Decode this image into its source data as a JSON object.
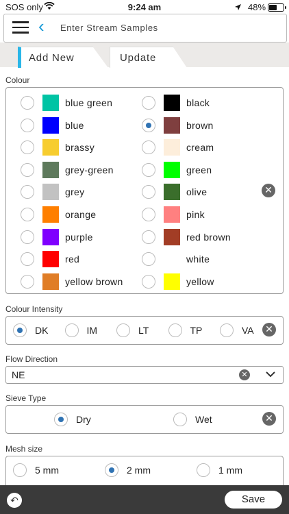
{
  "status_bar": {
    "carrier": "SOS only",
    "time": "9:24 am",
    "battery": "48%",
    "battery_level": 0.48
  },
  "header": {
    "title": "Enter Stream Samples"
  },
  "tabs": [
    {
      "label": "Add New",
      "active": true
    },
    {
      "label": "Update",
      "active": false
    }
  ],
  "colour": {
    "label": "Colour",
    "selected": "brown",
    "left": [
      {
        "name": "blue green",
        "hex": "#00c4a4"
      },
      {
        "name": "blue",
        "hex": "#0000ff"
      },
      {
        "name": "brassy",
        "hex": "#f7cd2f"
      },
      {
        "name": "grey-green",
        "hex": "#5e7a5c"
      },
      {
        "name": "grey",
        "hex": "#c2c2c2"
      },
      {
        "name": "orange",
        "hex": "#ff7f00"
      },
      {
        "name": "purple",
        "hex": "#7f00ff"
      },
      {
        "name": "red",
        "hex": "#ff0000"
      },
      {
        "name": "yellow brown",
        "hex": "#e07d26"
      }
    ],
    "right": [
      {
        "name": "black",
        "hex": "#000000"
      },
      {
        "name": "brown",
        "hex": "#7f3f3f"
      },
      {
        "name": "cream",
        "hex": "#fdeedb"
      },
      {
        "name": "green",
        "hex": "#00ff00"
      },
      {
        "name": "olive",
        "hex": "#3a6e2b"
      },
      {
        "name": "pink",
        "hex": "#ff8080"
      },
      {
        "name": "red brown",
        "hex": "#a23d25"
      },
      {
        "name": "white",
        "hex": "#ffffff"
      },
      {
        "name": "yellow",
        "hex": "#ffff00"
      }
    ]
  },
  "colour_intensity": {
    "label": "Colour Intensity",
    "options": [
      "DK",
      "IM",
      "LT",
      "TP",
      "VA"
    ],
    "selected": "DK"
  },
  "flow_direction": {
    "label": "Flow Direction",
    "value": "NE"
  },
  "sieve_type": {
    "label": "Sieve Type",
    "options": [
      "Dry",
      "Wet"
    ],
    "selected": "Dry"
  },
  "mesh_size": {
    "label": "Mesh size",
    "options": [
      "5 mm",
      "2 mm",
      "1 mm"
    ],
    "selected": "2 mm"
  },
  "footer": {
    "save_label": "Save"
  },
  "icons": {
    "clear": "clear-x-icon",
    "back": "chevron-left-icon",
    "menu": "hamburger-icon",
    "undo": "undo-icon",
    "dropdown": "chevron-down-icon"
  }
}
